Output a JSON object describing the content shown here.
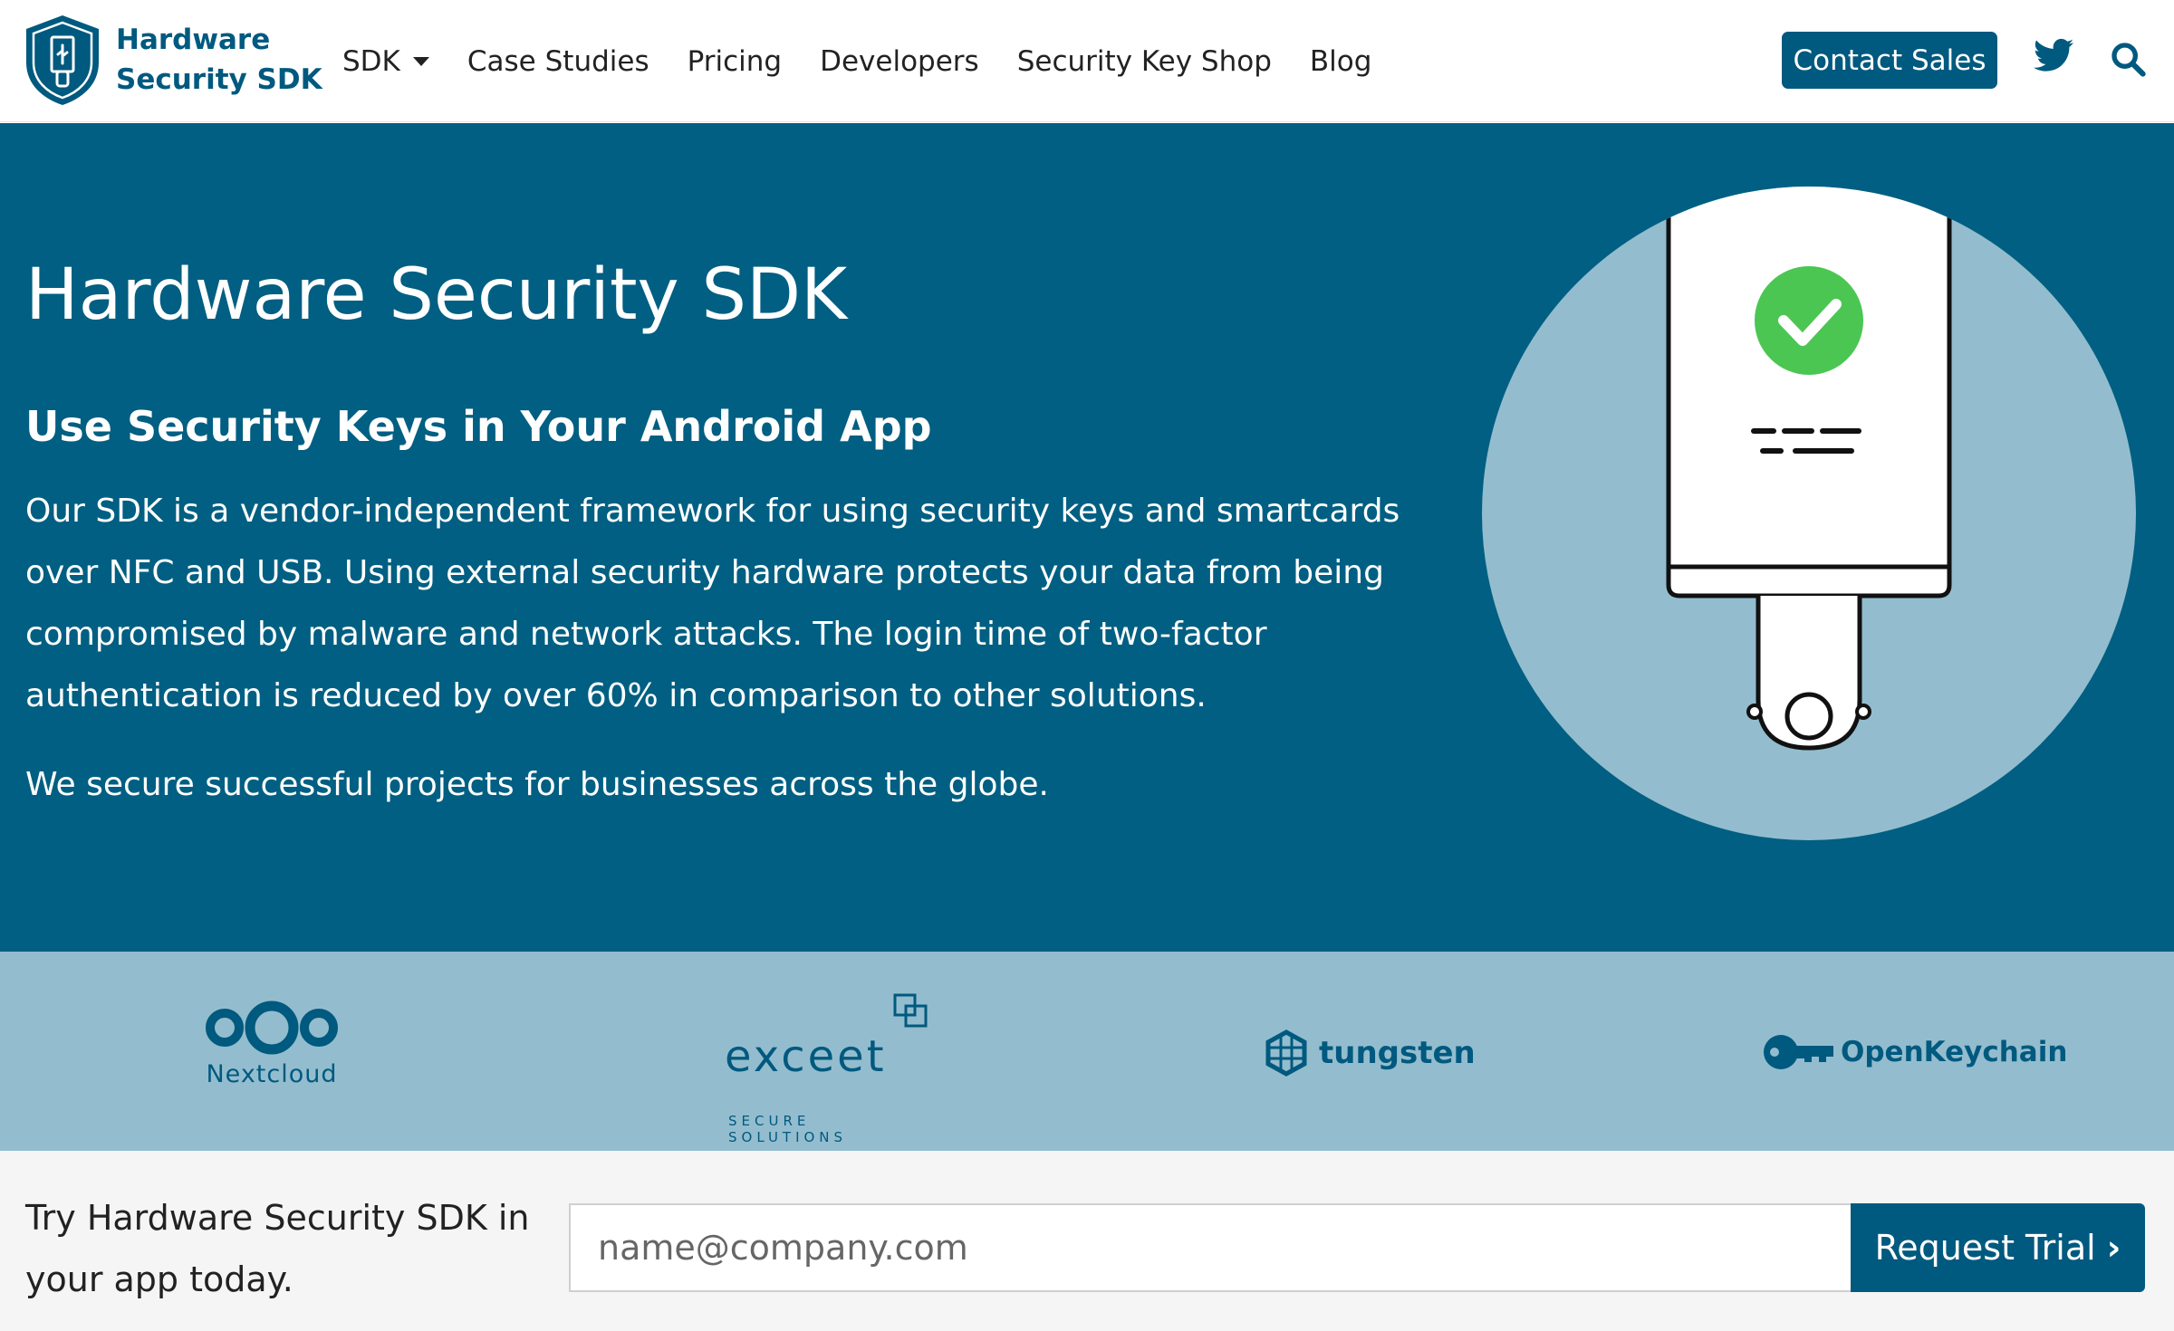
{
  "colors": {
    "brand": "#00597f",
    "hero_bg": "#005f82",
    "partners_bg": "#93bdce",
    "success": "#4cc653"
  },
  "header": {
    "logo_line1": "Hardware",
    "logo_line2": "Security SDK",
    "logo_icon": "shield-usb-icon",
    "nav": [
      {
        "label": "SDK",
        "has_dropdown": true
      },
      {
        "label": "Case Studies"
      },
      {
        "label": "Pricing"
      },
      {
        "label": "Developers"
      },
      {
        "label": "Security Key Shop"
      },
      {
        "label": "Blog"
      }
    ],
    "contact_label": "Contact Sales",
    "twitter_icon": "twitter-icon",
    "search_icon": "search-icon"
  },
  "hero": {
    "title": "Hardware Security SDK",
    "subtitle": "Use Security Keys in Your Android App",
    "description": "Our SDK is a vendor-independent framework for using security keys and smartcards over NFC and USB. Using external security hardware protects your data from being compromised by malware and network attacks. The login time of two-factor authentication is reduced by over 60% in comparison to other solutions.",
    "tagline": "We secure successful projects for businesses across the globe.",
    "illustration_icon": "security-key-checkmark-icon"
  },
  "partners": [
    {
      "name": "Nextcloud"
    },
    {
      "name": "exceet",
      "sub": "SECURE SOLUTIONS"
    },
    {
      "name": "tungsten"
    },
    {
      "name": "OpenKeychain"
    }
  ],
  "cta": {
    "text": "Try Hardware Security SDK in your app today.",
    "placeholder": "name@company.com",
    "button_label": "Request Trial",
    "button_chevron": "›"
  }
}
